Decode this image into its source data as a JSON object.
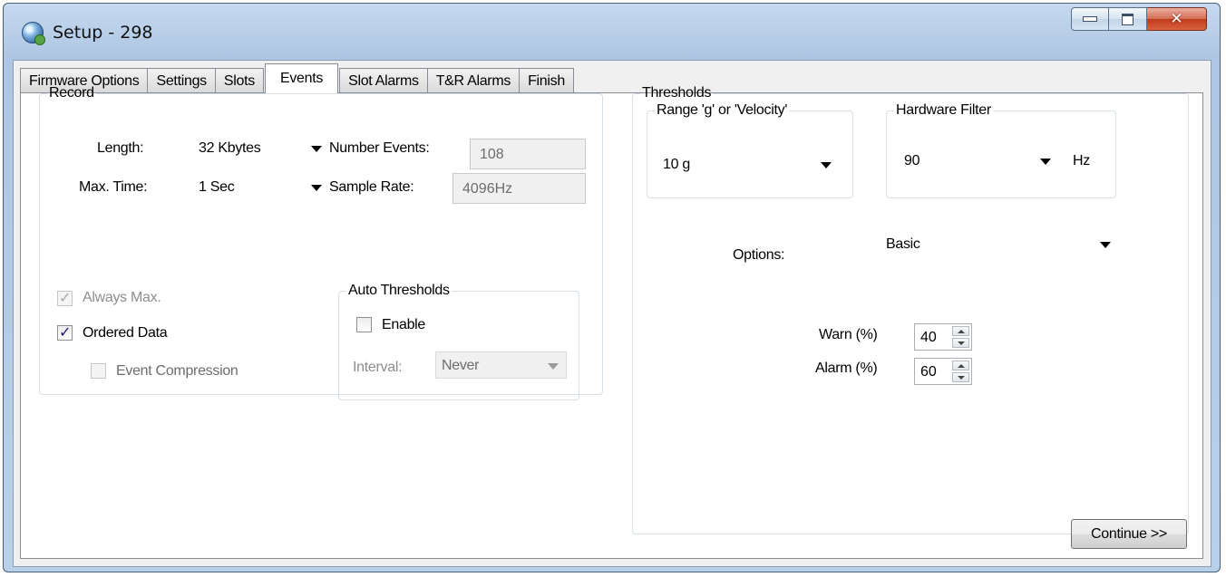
{
  "window": {
    "title": "Setup - 298"
  },
  "tabs": [
    {
      "label": "Firmware Options"
    },
    {
      "label": "Settings"
    },
    {
      "label": "Slots"
    },
    {
      "label": "Events",
      "active": true
    },
    {
      "label": "Slot Alarms"
    },
    {
      "label": "T&R Alarms"
    },
    {
      "label": "Finish"
    }
  ],
  "record": {
    "legend": "Record",
    "length_label": "Length:",
    "length_value": "32 Kbytes",
    "max_time_label": "Max. Time:",
    "max_time_value": "1 Sec",
    "number_events_label": "Number Events:",
    "number_events_value": "108",
    "sample_rate_label": "Sample Rate:",
    "sample_rate_value": "4096Hz",
    "always_max_label": "Always Max.",
    "always_max_checked": true,
    "ordered_data_label": "Ordered Data",
    "ordered_data_checked": true,
    "event_compression_label": "Event Compression",
    "event_compression_checked": false
  },
  "auto_thresholds": {
    "legend": "Auto Thresholds",
    "enable_label": "Enable",
    "enable_checked": false,
    "interval_label": "Interval:",
    "interval_value": "Never"
  },
  "thresholds": {
    "legend": "Thresholds",
    "range_legend": "Range 'g' or 'Velocity'",
    "range_value": "10 g",
    "hw_filter_legend": "Hardware Filter",
    "hw_filter_value": "90",
    "hw_filter_unit": "Hz",
    "options_label": "Options:",
    "options_value": "Basic",
    "warn_label": "Warn (%)",
    "warn_value": "40",
    "alarm_label": "Alarm (%)",
    "alarm_value": "60"
  },
  "continue_label": "Continue >>"
}
